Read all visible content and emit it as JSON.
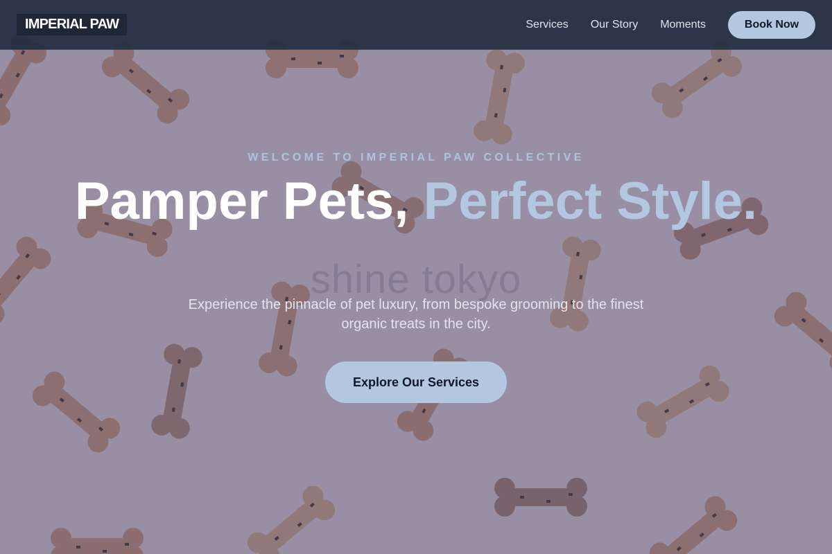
{
  "nav": {
    "logo": "IMPERIAL PAW",
    "links": [
      "Services",
      "Our Story",
      "Moments"
    ],
    "cta": "Book Now"
  },
  "hero": {
    "eyebrow": "WELCOME TO IMPERIAL PAW COLLECTIVE",
    "headline_main": "Pamper Pets,",
    "headline_accent": "Perfect Style.",
    "subtitle": "Experience the pinnacle of pet luxury, from bespoke grooming to the finest organic treats in the city.",
    "cta": "Explore Our Services",
    "background_image": "dog-bone-biscuits",
    "watermark": "shine tokyo"
  },
  "colors": {
    "accent": "#b3c7e0",
    "nav_bg": "#1e293b",
    "overlay": "#4e4668",
    "text_dark": "#0f172a"
  }
}
